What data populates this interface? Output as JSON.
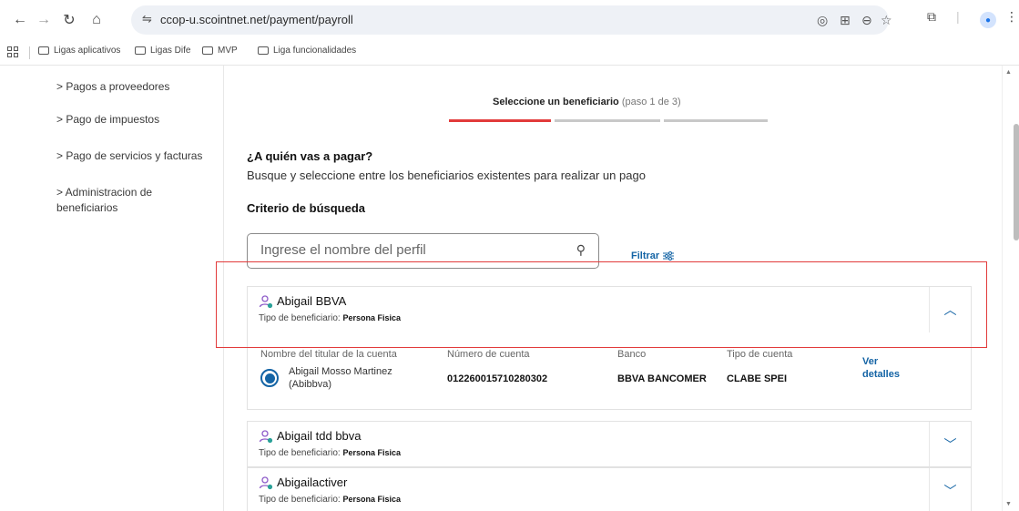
{
  "browser": {
    "url": "ccop-u.scointnet.net/payment/payroll",
    "bookmarks": [
      "Ligas aplicativos",
      "Ligas Dife",
      "MVP",
      "Liga funcionalidades"
    ]
  },
  "sidebar": {
    "items": [
      {
        "label": "> Pagos a proveedores"
      },
      {
        "label": "> Pago de impuestos"
      },
      {
        "label": "> Pago de servicios y facturas"
      },
      {
        "label": "> Administracion de beneficiarios"
      }
    ]
  },
  "stepper": {
    "title": "Seleccione un beneficiario",
    "step_text": "(paso 1 de 3)",
    "current_step": 1,
    "total_steps": 3,
    "active_color": "#e23b3b",
    "inactive_color": "#c8c8c8"
  },
  "main": {
    "question": "¿A quién vas a pagar?",
    "description": "Busque y seleccione entre los beneficiarios existentes para realizar un pago",
    "criteria_label": "Criterio de búsqueda",
    "search_placeholder": "Ingrese el nombre del perfil",
    "filter_label": "Filtrar"
  },
  "beneficiaries": [
    {
      "name": "Abigail BBVA",
      "type_label": "Tipo de beneficiario:",
      "type_value": "Persona Fisica",
      "expanded": true
    },
    {
      "name": "Abigail tdd bbva",
      "type_label": "Tipo de beneficiario:",
      "type_value": "Persona Fisica",
      "expanded": false
    },
    {
      "name": "Abigailactiver",
      "type_label": "Tipo de beneficiario:",
      "type_value": "Persona Fisica",
      "expanded": false
    }
  ],
  "detail": {
    "col_holder": "Nombre del titular de la cuenta",
    "col_account": "Número de cuenta",
    "col_bank": "Banco",
    "col_type": "Tipo de cuenta",
    "holder_name": "Abigail Mosso Martinez (Abibbva)",
    "account_number": "012260015710280302",
    "bank": "BBVA BANCOMER",
    "account_type": "CLABE SPEI",
    "details_link": "Ver detalles"
  },
  "colors": {
    "accent_blue": "#1464a5",
    "highlight_red": "#e23b3b"
  },
  "icons": [
    "back-icon",
    "forward-icon",
    "reload-icon",
    "home-icon",
    "site-settings-icon",
    "location-icon",
    "translate-icon",
    "zoom-icon",
    "star-icon",
    "extensions-icon",
    "profile-icon",
    "menu-icon",
    "apps-icon",
    "folder-icon",
    "search-icon",
    "filter-icon",
    "person-icon",
    "chevron-up-icon",
    "chevron-down-icon"
  ]
}
